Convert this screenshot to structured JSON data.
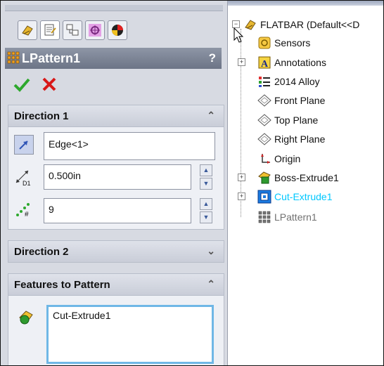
{
  "property_manager": {
    "tabs": [
      "feature-manager",
      "property-manager",
      "configuration-manager",
      "dimxpert-manager",
      "display-manager"
    ],
    "title": "LPattern1",
    "help": "?",
    "groups": {
      "direction1": {
        "title": "Direction 1",
        "edge_value": "Edge<1>",
        "spacing_value": "0.500in",
        "instances_value": "9"
      },
      "direction2": {
        "title": "Direction 2"
      },
      "features": {
        "title": "Features to Pattern",
        "items": [
          "Cut-Extrude1"
        ]
      }
    }
  },
  "feature_tree": {
    "root": "FLATBAR  (Default<<D",
    "items": [
      {
        "label": "Sensors"
      },
      {
        "label": "Annotations"
      },
      {
        "label": "2014 Alloy"
      },
      {
        "label": "Front Plane"
      },
      {
        "label": "Top Plane"
      },
      {
        "label": "Right Plane"
      },
      {
        "label": "Origin"
      },
      {
        "label": "Boss-Extrude1"
      },
      {
        "label": "Cut-Extrude1"
      },
      {
        "label": "LPattern1"
      }
    ],
    "colors": {
      "highlight": "#00c8ff",
      "preview": "#707070"
    }
  }
}
